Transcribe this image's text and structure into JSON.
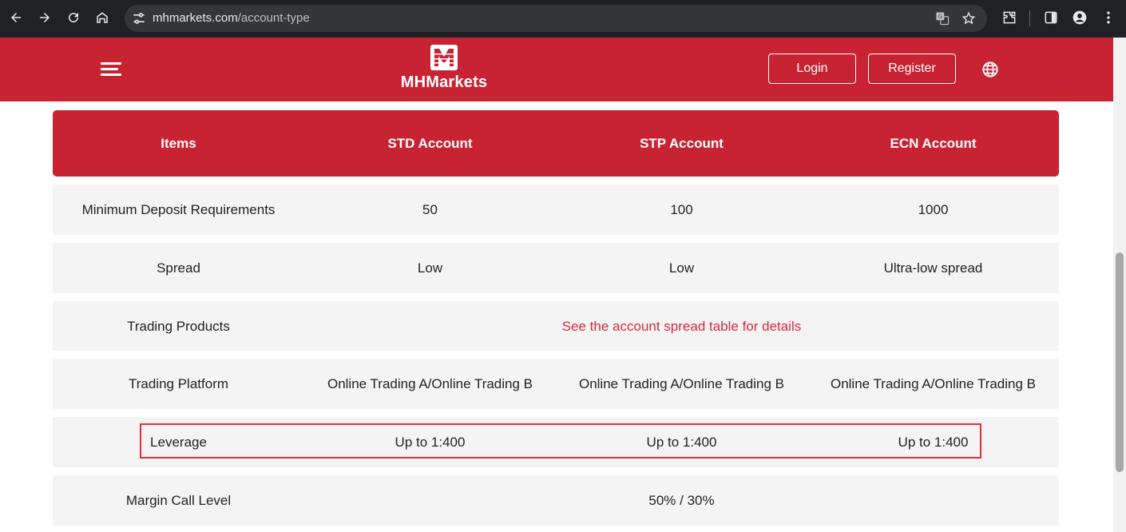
{
  "browser": {
    "url_host": "mhmarkets.com",
    "url_path": "/account-type"
  },
  "header": {
    "logo_letter": "M",
    "logo_text": "MHMarkets",
    "login_label": "Login",
    "register_label": "Register",
    "brand_color": "#c82333"
  },
  "table": {
    "headers": [
      "Items",
      "STD Account",
      "STP Account",
      "ECN Account"
    ],
    "rows": [
      {
        "item": "Minimum Deposit Requirements",
        "std": "50",
        "stp": "100",
        "ecn": "1000"
      },
      {
        "item": "Spread",
        "std": "Low",
        "stp": "Low",
        "ecn": "Ultra-low spread"
      },
      {
        "item": "Trading Products",
        "merged": "See the account spread table for details"
      },
      {
        "item": "Trading Platform",
        "std": "Online Trading A/Online Trading B",
        "stp": "Online Trading A/Online Trading B",
        "ecn": "Online Trading A/Online Trading B"
      },
      {
        "item": "Leverage",
        "std": "Up to 1:400",
        "stp": "Up to 1:400",
        "ecn": "Up to 1:400"
      },
      {
        "item": "Margin Call Level",
        "merged": "50% / 30%"
      }
    ]
  },
  "icons": {
    "back": "arrow-left-icon",
    "forward": "arrow-right-icon",
    "reload": "reload-icon",
    "home": "home-icon",
    "site_info": "tune-icon",
    "translate": "translate-icon",
    "bookmark": "star-icon",
    "extensions": "puzzle-icon",
    "sidepanel": "sidepanel-icon",
    "profile": "profile-icon",
    "menu": "kebab-menu-icon",
    "hamburger": "hamburger-icon",
    "globe": "globe-icon"
  }
}
